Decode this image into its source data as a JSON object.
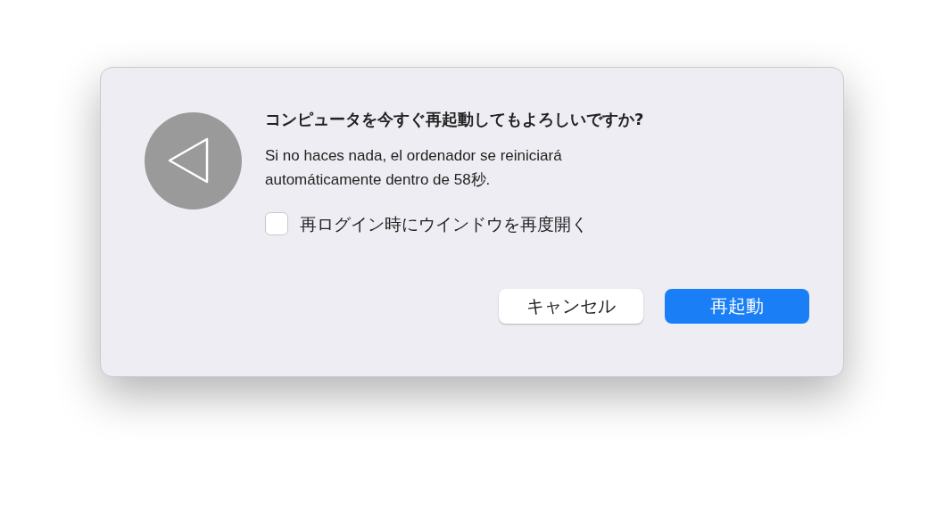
{
  "dialog": {
    "title": "コンピュータを今すぐ再起動してもよろしいですか?",
    "message": "Si no haces nada, el ordenador se reiniciará automáticamente dentro de 58秒.",
    "checkbox": {
      "label": "再ログイン時にウインドウを再度開く",
      "checked": false
    },
    "buttons": [
      {
        "label": "キャンセル",
        "kind": "secondary"
      },
      {
        "label": "再起動",
        "kind": "primary"
      }
    ]
  }
}
